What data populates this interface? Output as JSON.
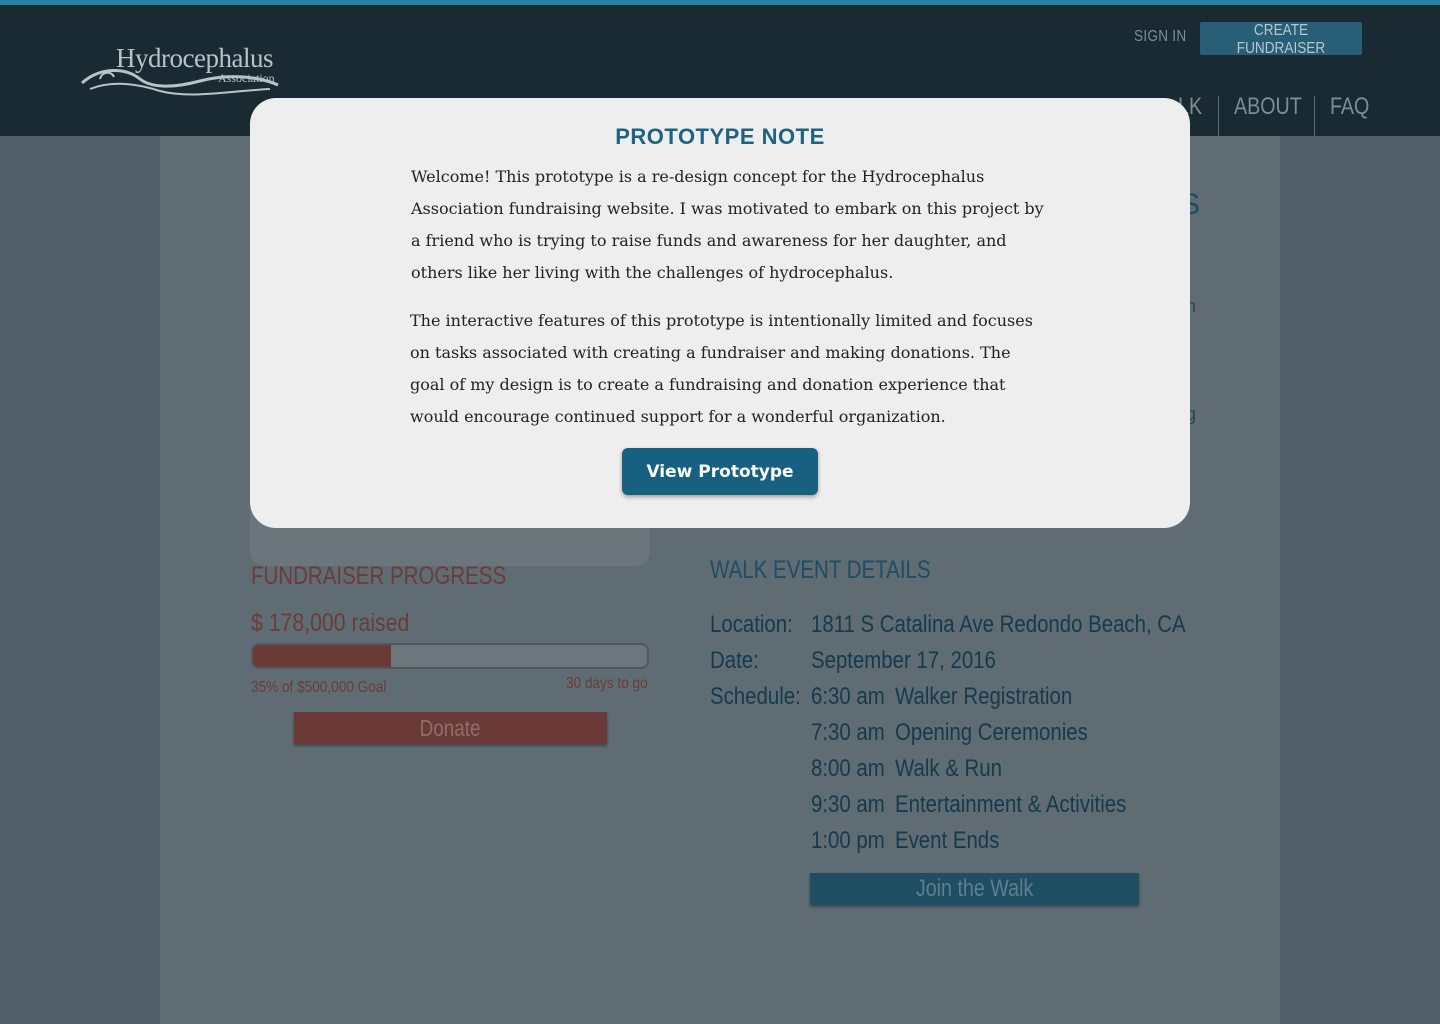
{
  "header": {
    "logo": {
      "main": "Hydrocephalus",
      "sub": "Association"
    },
    "sign_in": "SIGN IN",
    "create_fundraiser": "CREATE FUNDRAISER",
    "nav": {
      "walk": "LK",
      "about": "ABOUT",
      "faq": "FAQ"
    }
  },
  "background": {
    "title_fragment": "S",
    "text_fragment_1": "n",
    "text_fragment_2": "g"
  },
  "progress": {
    "title": "FUNDRAISER PROGRESS",
    "raised": "$ 178,000 raised",
    "fraction": 0.35,
    "percent_text": "35% of $500,000 Goal",
    "days_left": "30 days to go",
    "donate": "Donate"
  },
  "walk": {
    "title": "WALK EVENT DETAILS",
    "location_label": "Location:",
    "location": "1811 S Catalina Ave Redondo Beach, CA",
    "date_label": "Date:",
    "date": "September 17, 2016",
    "schedule_label": "Schedule:",
    "schedule": [
      {
        "time": "6:30 am",
        "event": "Walker Registration"
      },
      {
        "time": "7:30 am",
        "event": "Opening Ceremonies"
      },
      {
        "time": "8:00 am",
        "event": "Walk & Run"
      },
      {
        "time": "9:30 am",
        "event": "Entertainment & Activities"
      },
      {
        "time": "1:00 pm",
        "event": "Event Ends"
      }
    ],
    "join": "Join the Walk"
  },
  "modal": {
    "title": "PROTOTYPE NOTE",
    "paragraph1": "Welcome!  This prototype is a re-design concept for the Hydrocephalus Association fundraising website.  I was motivated to embark on this project by a friend who is trying to raise funds and awareness for her daughter, and others like her living with the challenges of hydrocephalus.",
    "paragraph2": "The interactive features of this prototype is intentionally limited and focuses on tasks associated with creating a fundraiser and making donations.  The goal of my design is to create a fundraising and donation experience that would encourage continued support for a wonderful organization.",
    "button": "View Prototype"
  },
  "colors": {
    "header_bg": "#1a2a33",
    "brand_blue": "#17607f",
    "title_blue": "#1d6382",
    "progress_red": "#6b3a37",
    "overlay_page": "#5f6c74"
  }
}
